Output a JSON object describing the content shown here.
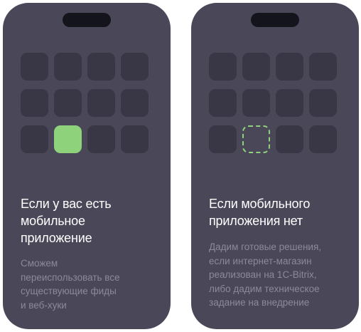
{
  "cards": [
    {
      "title_lines": [
        "Если у вас есть",
        "мобильное",
        "приложение"
      ],
      "description_lines": [
        "Сможем",
        "переиспользовать все",
        "существующие фиды",
        "и веб-хуки"
      ],
      "highlight_tile": "filled-green"
    },
    {
      "title_lines": [
        "Если мобильного",
        "приложения нет"
      ],
      "description_lines": [
        "Дадим готовые решения,",
        "если интернет-магазин",
        "реализован на 1С-Bitrix,",
        "либо дадим техническое",
        "задание на внедрение"
      ],
      "highlight_tile": "dashed-green-outline"
    }
  ],
  "colors": {
    "phone_background": "#4a4758",
    "tile": "#393646",
    "accent_green": "#8ed27b",
    "notch": "#14141d",
    "title_text": "#ffffff",
    "description_text": "#8c8999"
  }
}
